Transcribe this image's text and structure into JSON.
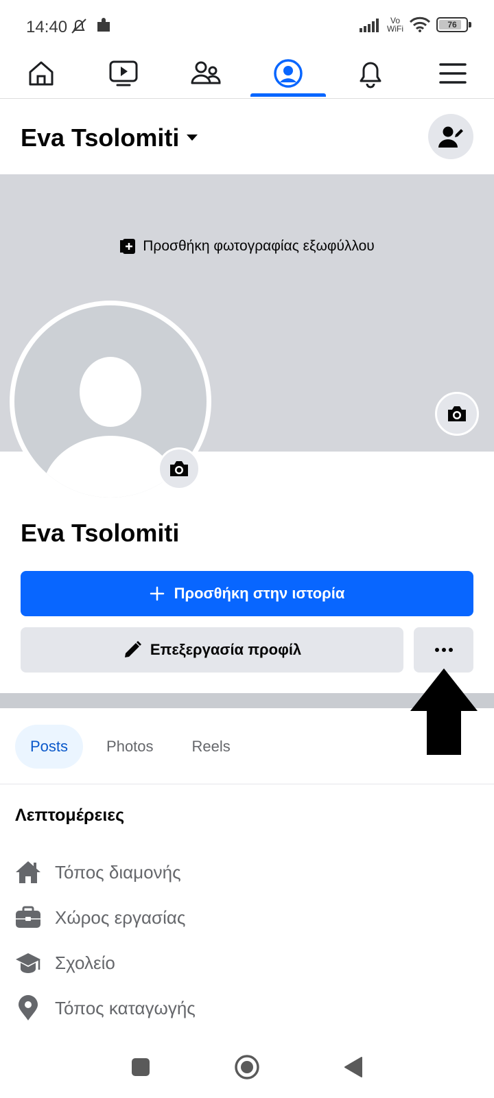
{
  "status_bar": {
    "time": "14:40",
    "vowifi_top": "Vo",
    "vowifi_bottom": "WiFi",
    "battery": "76"
  },
  "tabs": [
    {
      "name": "home",
      "icon": "home-icon"
    },
    {
      "name": "watch",
      "icon": "video-icon"
    },
    {
      "name": "friends",
      "icon": "friends-icon"
    },
    {
      "name": "profile",
      "icon": "profile-icon",
      "active": true
    },
    {
      "name": "notifications",
      "icon": "bell-icon"
    },
    {
      "name": "menu",
      "icon": "menu-icon"
    }
  ],
  "header": {
    "name": "Eva Tsolomiti"
  },
  "cover": {
    "add_cover_label": "Προσθήκη φωτογραφίας εξωφύλλου"
  },
  "profile": {
    "name": "Eva Tsolomiti"
  },
  "buttons": {
    "add_story": "Προσθήκη στην ιστορία",
    "edit_profile": "Επεξεργασία προφίλ"
  },
  "subtabs": [
    "Posts",
    "Photos",
    "Reels"
  ],
  "details": {
    "title": "Λεπτομέρειες",
    "items": [
      {
        "label": "Τόπος διαμονής",
        "icon": "home-filled-icon"
      },
      {
        "label": "Χώρος εργασίας",
        "icon": "briefcase-icon"
      },
      {
        "label": "Σχολείο",
        "icon": "graduation-cap-icon"
      },
      {
        "label": "Τόπος καταγωγής",
        "icon": "location-pin-icon"
      }
    ]
  },
  "colors": {
    "accent": "#0866ff",
    "button_grey": "#e4e6eb",
    "cover_grey": "#d4d6db",
    "secondary_text": "#65676b"
  }
}
